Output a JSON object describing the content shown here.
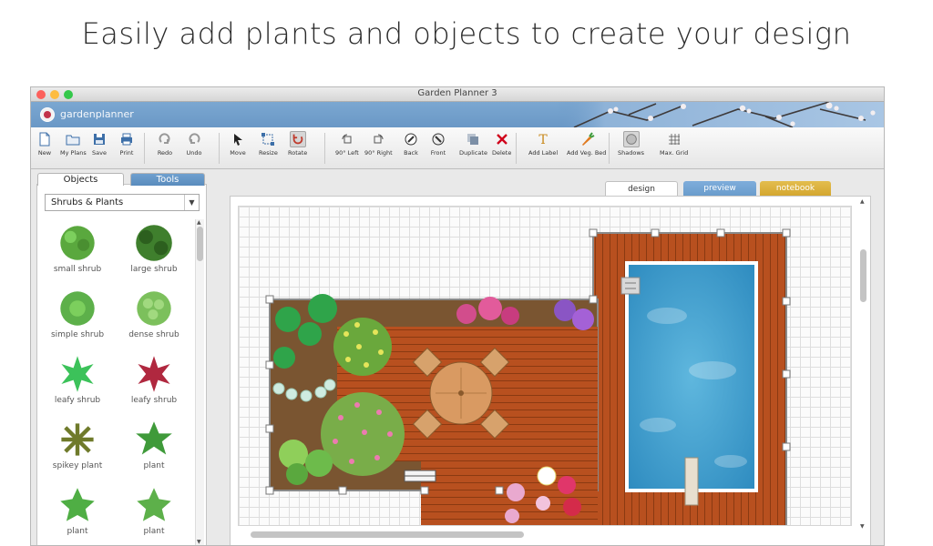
{
  "headline": "Easily add plants and objects to create your design",
  "window": {
    "title": "Garden Planner 3",
    "brand": "gardenplanner"
  },
  "toolbar": {
    "buttons": [
      {
        "label": "New",
        "icon": "new-document-icon"
      },
      {
        "label": "My Plans",
        "icon": "folder-icon"
      },
      {
        "label": "Save",
        "icon": "save-disk-icon"
      },
      {
        "label": "Print",
        "icon": "print-icon"
      },
      {
        "label": "Redo",
        "icon": "redo-icon"
      },
      {
        "label": "Undo",
        "icon": "undo-icon"
      },
      {
        "label": "Move",
        "icon": "arrow-cursor-icon"
      },
      {
        "label": "Resize",
        "icon": "resize-icon"
      },
      {
        "label": "Rotate",
        "icon": "rotate-icon"
      },
      {
        "label": "90° Left",
        "icon": "rotate-left-icon"
      },
      {
        "label": "90° Right",
        "icon": "rotate-right-icon"
      },
      {
        "label": "Back",
        "icon": "send-back-icon"
      },
      {
        "label": "Front",
        "icon": "bring-front-icon"
      },
      {
        "label": "Duplicate",
        "icon": "duplicate-icon"
      },
      {
        "label": "Delete",
        "icon": "delete-x-icon"
      },
      {
        "label": "Add Label",
        "icon": "text-label-icon"
      },
      {
        "label": "Add Veg. Bed",
        "icon": "veg-bed-icon"
      },
      {
        "label": "Shadows",
        "icon": "shadow-icon"
      },
      {
        "label": "Max. Grid",
        "icon": "grid-icon"
      }
    ]
  },
  "sidebar": {
    "tabs": [
      "Objects",
      "Tools"
    ],
    "category": "Shrubs & Plants",
    "items": [
      {
        "label": "small shrub",
        "color": "#5aa83e"
      },
      {
        "label": "large shrub",
        "color": "#3f7f2d"
      },
      {
        "label": "simple shrub",
        "color": "#5db04a"
      },
      {
        "label": "dense shrub",
        "color": "#7cc05c"
      },
      {
        "label": "leafy shrub",
        "color": "#3cc25a"
      },
      {
        "label": "leafy shrub",
        "color": "#b0283f"
      },
      {
        "label": "spikey plant",
        "color": "#6f7a2a"
      },
      {
        "label": "plant",
        "color": "#3f9a3a"
      },
      {
        "label": "plant",
        "color": "#4fae44"
      },
      {
        "label": "plant",
        "color": "#5db04a"
      }
    ]
  },
  "view_tabs": [
    "design",
    "preview",
    "notebook"
  ],
  "colors": {
    "deck": "#b8501f",
    "soil": "#7a5531",
    "water": "#3f9fd0",
    "accent_blue": "#6a98c6"
  }
}
